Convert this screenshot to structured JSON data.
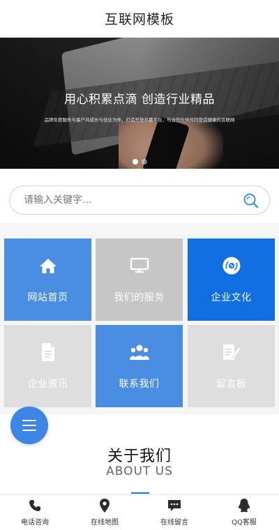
{
  "header": {
    "title": "互联网模板"
  },
  "banner": {
    "headline": "用心积累点滴 创造行业精品",
    "subline": "品牌年度服务与客户共成长与创业为伴，打造开放共赢平台，与合作伙伴共同营造健康的互联网",
    "slides": 2,
    "active_slide": 1
  },
  "search": {
    "placeholder": "请输入关键字..."
  },
  "grid": {
    "tiles": [
      {
        "label": "网站首页",
        "icon": "home-icon"
      },
      {
        "label": "我们的服务",
        "icon": "monitor-icon"
      },
      {
        "label": "企业文化",
        "icon": "disc-icon"
      },
      {
        "label": "企业资讯",
        "icon": "document-icon"
      },
      {
        "label": "联系我们",
        "icon": "team-icon"
      },
      {
        "label": "留言板",
        "icon": "note-edit-icon"
      }
    ]
  },
  "fab": {
    "icon": "menu-icon"
  },
  "about": {
    "title_zh": "关于我们",
    "title_en": "ABOUT US"
  },
  "bottom_nav": {
    "items": [
      {
        "label": "电话咨询",
        "icon": "phone-icon"
      },
      {
        "label": "在线地图",
        "icon": "map-pin-icon"
      },
      {
        "label": "在线留言",
        "icon": "chat-icon"
      },
      {
        "label": "QQ客服",
        "icon": "qq-penguin-icon"
      }
    ]
  },
  "colors": {
    "accent": "#0f6fe0",
    "tile_blue": "#4a8ee3",
    "tile_gray": "#c6c6c6",
    "tile_light": "#dedede",
    "fab": "#3d86e6"
  }
}
